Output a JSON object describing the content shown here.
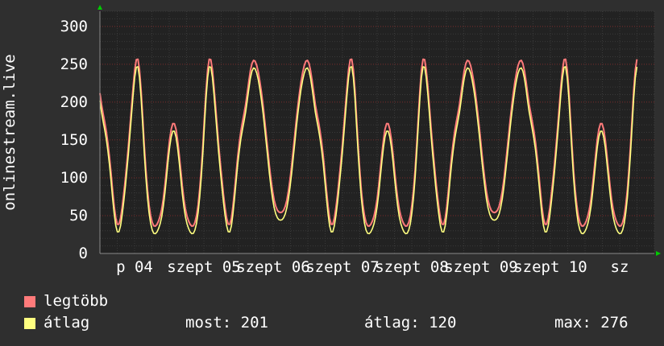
{
  "chart_data": {
    "type": "line",
    "ylabel": "onlinestream.live",
    "ylim": [
      0,
      320
    ],
    "yticks": [
      0,
      50,
      100,
      150,
      200,
      250,
      300
    ],
    "xticks": [
      "p 04",
      "szept 05",
      "szept 06",
      "szept 07",
      "szept 08",
      "szept 09",
      "szept 10",
      "sz"
    ],
    "x": [
      0.0,
      0.1,
      0.2,
      0.3,
      0.4,
      0.5,
      0.6,
      0.7,
      0.8,
      0.9,
      1.0,
      1.1,
      1.2,
      1.3,
      1.4,
      1.5,
      1.6,
      1.7,
      1.8,
      1.9,
      2.0,
      2.1,
      2.2,
      2.3,
      2.4,
      2.5,
      2.6,
      2.7,
      2.8,
      2.9,
      3.0,
      3.1,
      3.2,
      3.3,
      3.4,
      3.5,
      3.6,
      3.7,
      3.8,
      3.9,
      4.0,
      4.1,
      4.2,
      4.3,
      4.4,
      4.5,
      4.6,
      4.7,
      4.8,
      4.9,
      5.0,
      5.1,
      5.2,
      5.3,
      5.4,
      5.5,
      5.6,
      5.7,
      5.8,
      5.9,
      6.0,
      6.1,
      6.2,
      6.3,
      6.4,
      6.5,
      6.6,
      6.7,
      6.8,
      6.9,
      7.0,
      7.1,
      7.2,
      7.3,
      7.4,
      7.5,
      7.6,
      7.7,
      7.8,
      7.9,
      8.0,
      8.1,
      8.2,
      8.3,
      8.4,
      8.5,
      8.6,
      8.7,
      8.8,
      8.9,
      9.0,
      9.1,
      9.2,
      9.3,
      9.4,
      9.5,
      9.6,
      9.7,
      9.8,
      9.9,
      10.0,
      10.1,
      10.2,
      10.3,
      10.4,
      10.5,
      10.6,
      10.7,
      10.8,
      10.9,
      11.0,
      11.1,
      11.2,
      11.3,
      11.4,
      11.5,
      11.6,
      11.7,
      11.8,
      11.9,
      12.0,
      12.1,
      12.2,
      12.3,
      12.4,
      12.5,
      12.6,
      12.7,
      12.8,
      12.9,
      13.0,
      13.1,
      13.2,
      13.3,
      13.4,
      13.5,
      13.6,
      13.7,
      13.8,
      13.9,
      14.0,
      14.1,
      14.2,
      14.3,
      14.4,
      14.5,
      14.6,
      14.7,
      14.8,
      14.9,
      15.0,
      15.1,
      15.2,
      15.3,
      15.4,
      15.5,
      15.6,
      15.7,
      15.8,
      15.9,
      16.0,
      16.1,
      16.2,
      16.3,
      16.4,
      16.5,
      16.6,
      16.7,
      16.8,
      16.9,
      17.0,
      17.1,
      17.2,
      17.3,
      17.4,
      17.5,
      17.6,
      17.7,
      17.8,
      17.9,
      18.0,
      18.1,
      18.2,
      18.3,
      18.4,
      18.5,
      18.6,
      18.7,
      18.8,
      18.9,
      19.0,
      19.1,
      19.2,
      19.3,
      19.4,
      19.5,
      19.6,
      19.7,
      19.8,
      19.9,
      20.0,
      20.1,
      20.2,
      20.3,
      20.4,
      20.5,
      20.6,
      20.7,
      20.8,
      20.9,
      21.0,
      21.1,
      21.2,
      21.3,
      21.4,
      21.5,
      21.6,
      21.7,
      21.8,
      21.9,
      22.0,
      22.1,
      22.2,
      22.3,
      22.4,
      22.5,
      22.6,
      22.7,
      22.8,
      22.9,
      23.0,
      23.1,
      23.2,
      23.3,
      23.4,
      23.5,
      23.6,
      23.7,
      23.8,
      23.9,
      24.0,
      24.1,
      24.2,
      24.3,
      24.4,
      24.5,
      24.6,
      24.7,
      24.8,
      24.9,
      25.0,
      25.1,
      25.2,
      25.3,
      25.4,
      25.5,
      25.6,
      25.7,
      25.8,
      25.9,
      26.0,
      26.1,
      26.2,
      26.3,
      26.4,
      26.5,
      26.6,
      26.7,
      26.8,
      26.9,
      27.0,
      27.1,
      27.2,
      27.3,
      27.4,
      27.5,
      27.6,
      27.7,
      27.8,
      27.9,
      28.0,
      28.1,
      28.2,
      28.3,
      28.4,
      28.5,
      28.6,
      28.7,
      28.8,
      28.9,
      29.0,
      29.1,
      29.2,
      29.3,
      29.4,
      29.5,
      29.6,
      29.7,
      29.8,
      29.9,
      30.0,
      30.1,
      30.2,
      30.3,
      30.4,
      30.5,
      30.6,
      30.7,
      30.8,
      30.9,
      31.0,
      31.1,
      31.2,
      31.3,
      31.4,
      31.5,
      31.6,
      31.7,
      31.8,
      31.9,
      32.0,
      32.1,
      32.2,
      32.3,
      32.4,
      32.5,
      32.6,
      32.7,
      32.8,
      32.9,
      33.0,
      33.1,
      33.2,
      33.3,
      33.4,
      33.5,
      33.6,
      33.7,
      33.8,
      33.9,
      34.0,
      34.1,
      34.2,
      34.3,
      34.4,
      34.5,
      34.6,
      34.7,
      34.8,
      34.9,
      35.0
    ],
    "series": [
      {
        "name": "legtöbb",
        "color": "#ff7a7a",
        "values": [
          211.8,
          196.7,
          185.0,
          173.7,
          161.4,
          146.3,
          127.9,
          106.3,
          83.5,
          62.5,
          46.7,
          38.5,
          38.7,
          46.5,
          60.2,
          77.8,
          97.7,
          119.3,
          142.5,
          167.7,
          194.4,
          220.7,
          242.8,
          256.1,
          256.6,
          242.6,
          215.3,
          179.8,
          143.2,
          111.0,
          84.4,
          64.3,
          50.0,
          41.0,
          36.6,
          36.1,
          38.4,
          42.7,
          49.1,
          58.5,
          71.8,
          89.4,
          110.1,
          131.5,
          150.4,
          164.3,
          171.6,
          171.5,
          164.2,
          150.4,
          131.5,
          110.1,
          89.4,
          71.8,
          58.5,
          49.1,
          42.7,
          38.4,
          36.1,
          36.6,
          41.0,
          50.0,
          64.3,
          84.4,
          111.0,
          143.2,
          179.8,
          215.3,
          242.6,
          256.6,
          256.1,
          242.8,
          220.7,
          194.4,
          167.7,
          142.5,
          119.3,
          97.7,
          77.8,
          60.2,
          46.5,
          38.7,
          38.5,
          46.7,
          62.5,
          83.5,
          106.3,
          127.9,
          146.3,
          161.4,
          173.7,
          185.0,
          196.7,
          211.8,
          227.5,
          241.4,
          251.1,
          255.2,
          254.0,
          248.3,
          239.1,
          227.0,
          212.3,
          195.3,
          176.4,
          156.2,
          135.6,
          115.6,
          97.5,
          82.2,
          70.5,
          62.3,
          57.2,
          54.7,
          54.0,
          54.7,
          57.2,
          62.3,
          70.5,
          82.2,
          97.5,
          115.6,
          135.6,
          156.2,
          176.4,
          195.3,
          212.3,
          227.0,
          239.1,
          248.3,
          254.0,
          255.2,
          251.1,
          241.4,
          227.5,
          211.8,
          196.7,
          185.0,
          173.7,
          161.4,
          146.3,
          127.9,
          106.3,
          83.5,
          62.5,
          46.7,
          38.5,
          38.7,
          46.5,
          60.2,
          77.8,
          97.7,
          119.3,
          142.5,
          167.7,
          194.4,
          220.7,
          242.8,
          256.1,
          256.6,
          242.6,
          215.3,
          179.8,
          143.2,
          111.0,
          84.4,
          64.3,
          50.0,
          41.0,
          36.6,
          36.1,
          38.4,
          42.7,
          49.1,
          58.5,
          71.8,
          89.4,
          110.1,
          131.5,
          150.4,
          164.3,
          171.6,
          171.5,
          164.2,
          150.4,
          131.5,
          110.1,
          89.4,
          71.8,
          58.5,
          49.1,
          42.7,
          38.4,
          36.1,
          36.6,
          41.0,
          50.0,
          64.3,
          84.4,
          111.0,
          143.2,
          179.8,
          215.3,
          242.6,
          256.6,
          256.1,
          242.8,
          220.7,
          194.4,
          167.7,
          142.5,
          119.3,
          97.7,
          77.8,
          60.2,
          46.5,
          38.7,
          38.5,
          46.7,
          62.5,
          83.5,
          106.3,
          127.9,
          146.3,
          161.4,
          173.7,
          185.0,
          196.7,
          211.8,
          227.5,
          241.4,
          251.1,
          255.2,
          254.0,
          248.3,
          239.1,
          227.0,
          212.3,
          195.3,
          176.4,
          156.2,
          135.6,
          115.6,
          97.5,
          82.2,
          70.5,
          62.3,
          57.2,
          54.7,
          54.0,
          54.7,
          57.2,
          62.3,
          70.5,
          82.2,
          97.5,
          115.6,
          135.6,
          156.2,
          176.4,
          195.3,
          212.3,
          227.0,
          239.1,
          248.3,
          254.0,
          255.2,
          251.1,
          241.4,
          227.5,
          211.8,
          196.7,
          185.0,
          173.7,
          161.4,
          146.3,
          127.9,
          106.3,
          83.5,
          62.5,
          46.7,
          38.5,
          38.7,
          46.5,
          60.2,
          77.8,
          97.7,
          119.3,
          142.5,
          167.7,
          194.4,
          220.7,
          242.8,
          256.1,
          256.6,
          242.6,
          215.3,
          179.8,
          143.2,
          111.0,
          84.4,
          64.3,
          50.0,
          41.0,
          36.6,
          36.1,
          38.4,
          42.7,
          49.1,
          58.5,
          71.8,
          89.4,
          110.1,
          131.5,
          150.4,
          164.3,
          171.6,
          171.5,
          164.2,
          150.4,
          131.5,
          110.1,
          89.4,
          71.8,
          58.5,
          49.1,
          42.7,
          38.4,
          36.1,
          36.6,
          41.0,
          50.0,
          64.3,
          84.4,
          111.0,
          143.2,
          179.8,
          215.3,
          242.6,
          256.6
        ]
      },
      {
        "name": "átlag",
        "color": "#ffff80",
        "values": [
          201.8,
          186.7,
          175.0,
          163.7,
          151.4,
          136.3,
          117.9,
          96.3,
          73.5,
          52.5,
          36.7,
          28.5,
          28.7,
          36.5,
          50.2,
          67.8,
          87.7,
          109.3,
          132.5,
          157.7,
          184.4,
          210.7,
          232.8,
          246.1,
          246.6,
          232.6,
          205.3,
          169.8,
          133.2,
          101.0,
          74.4,
          54.3,
          40.0,
          31.0,
          26.6,
          26.1,
          28.4,
          32.7,
          39.1,
          48.5,
          61.8,
          79.4,
          100.1,
          121.5,
          140.4,
          154.3,
          161.6,
          161.5,
          154.2,
          140.4,
          121.5,
          100.1,
          79.4,
          61.8,
          48.5,
          39.1,
          32.7,
          28.4,
          26.1,
          26.6,
          31.0,
          40.0,
          54.3,
          74.4,
          101.0,
          133.2,
          169.8,
          205.3,
          232.6,
          246.6,
          246.1,
          232.8,
          210.7,
          184.4,
          157.7,
          132.5,
          109.3,
          87.7,
          67.8,
          50.2,
          36.5,
          28.7,
          28.5,
          36.7,
          52.5,
          73.5,
          96.3,
          117.9,
          136.3,
          151.4,
          163.7,
          175.0,
          186.7,
          201.8,
          217.5,
          231.4,
          241.1,
          245.2,
          244.0,
          238.3,
          229.1,
          217.0,
          202.3,
          185.3,
          166.4,
          146.2,
          125.6,
          105.6,
          87.5,
          72.2,
          60.5,
          52.3,
          47.2,
          44.7,
          44.0,
          44.7,
          47.2,
          52.3,
          60.5,
          72.2,
          87.5,
          105.6,
          125.6,
          146.2,
          166.4,
          185.3,
          202.3,
          217.0,
          229.1,
          238.3,
          244.0,
          245.2,
          241.1,
          231.4,
          217.5,
          201.8,
          186.7,
          175.0,
          163.7,
          151.4,
          136.3,
          117.9,
          96.3,
          73.5,
          52.5,
          36.7,
          28.5,
          28.7,
          36.5,
          50.2,
          67.8,
          87.7,
          109.3,
          132.5,
          157.7,
          184.4,
          210.7,
          232.8,
          246.1,
          246.6,
          232.6,
          205.3,
          169.8,
          133.2,
          101.0,
          74.4,
          54.3,
          40.0,
          31.0,
          26.6,
          26.1,
          28.4,
          32.7,
          39.1,
          48.5,
          61.8,
          79.4,
          100.1,
          121.5,
          140.4,
          154.3,
          161.6,
          161.5,
          154.2,
          140.4,
          121.5,
          100.1,
          79.4,
          61.8,
          48.5,
          39.1,
          32.7,
          28.4,
          26.1,
          26.6,
          31.0,
          40.0,
          54.3,
          74.4,
          101.0,
          133.2,
          169.8,
          205.3,
          232.6,
          246.6,
          246.1,
          232.8,
          210.7,
          184.4,
          157.7,
          132.5,
          109.3,
          87.7,
          67.8,
          50.2,
          36.5,
          28.7,
          28.5,
          36.7,
          52.5,
          73.5,
          96.3,
          117.9,
          136.3,
          151.4,
          163.7,
          175.0,
          186.7,
          201.8,
          217.5,
          231.4,
          241.1,
          245.2,
          244.0,
          238.3,
          229.1,
          217.0,
          202.3,
          185.3,
          166.4,
          146.2,
          125.6,
          105.6,
          87.5,
          72.2,
          60.5,
          52.3,
          47.2,
          44.7,
          44.0,
          44.7,
          47.2,
          52.3,
          60.5,
          72.2,
          87.5,
          105.6,
          125.6,
          146.2,
          166.4,
          185.3,
          202.3,
          217.0,
          229.1,
          238.3,
          244.0,
          245.2,
          241.1,
          231.4,
          217.5,
          201.8,
          186.7,
          175.0,
          163.7,
          151.4,
          136.3,
          117.9,
          96.3,
          73.5,
          52.5,
          36.7,
          28.5,
          28.7,
          36.5,
          50.2,
          67.8,
          87.7,
          109.3,
          132.5,
          157.7,
          184.4,
          210.7,
          232.8,
          246.1,
          246.6,
          232.6,
          205.3,
          169.8,
          133.2,
          101.0,
          74.4,
          54.3,
          40.0,
          31.0,
          26.6,
          26.1,
          28.4,
          32.7,
          39.1,
          48.5,
          61.8,
          79.4,
          100.1,
          121.5,
          140.4,
          154.3,
          161.6,
          161.5,
          154.2,
          140.4,
          121.5,
          100.1,
          79.4,
          61.8,
          48.5,
          39.1,
          32.7,
          28.4,
          26.1,
          26.6,
          31.0,
          40.0,
          54.3,
          74.4,
          101.0,
          133.2,
          169.8,
          205.3,
          232.6,
          246.6
        ]
      }
    ],
    "grid": true
  },
  "legend": {
    "max_label": "legtöbb",
    "avg_label": "átlag",
    "now_label": "most: 201",
    "avg_stat": "átlag: 120",
    "max_stat": "max: 276"
  },
  "colors": {
    "background": "#2f2f2f",
    "plot_background": "#222222",
    "grid_minor": "#3a3a3a",
    "grid_major": "#7a2a2a",
    "axis": "#8a8a8a",
    "arrow": "#00cc00",
    "text": "#ffffff"
  }
}
